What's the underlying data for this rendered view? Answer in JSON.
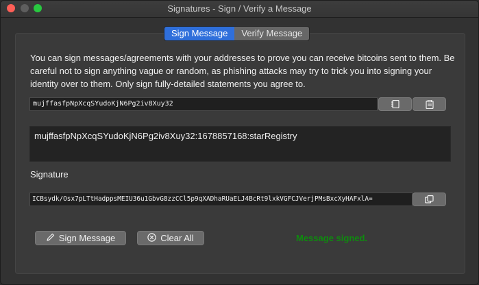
{
  "window": {
    "title": "Signatures - Sign / Verify a Message"
  },
  "tabs": [
    {
      "label": "Sign Message",
      "active": true
    },
    {
      "label": "Verify Message",
      "active": false
    }
  ],
  "sign": {
    "description": "You can sign messages/agreements with your addresses to prove you can receive bitcoins sent to them. Be careful not to sign anything vague or random, as phishing attacks may try to trick you into signing your identity over to them. Only sign fully-detailed statements you agree to.",
    "address_value": "mujffasfpNpXcqSYudoKjN6Pg2iv8Xuy32",
    "message_value": "mujffasfpNpXcqSYudoKjN6Pg2iv8Xuy32:1678857168:starRegistry",
    "signature_label": "Signature",
    "signature_value": "ICBsydk/Osx7pLTtHadppsMEIU36u1GbvG8zzCCl5p9qXADhaRUaELJ4BcRt9lxkVGFCJVerjPMsBxcXyHAFxlA=",
    "sign_button": "Sign Message",
    "clear_button": "Clear All",
    "status": "Message signed."
  },
  "icons": {
    "address_book": "address-book-icon",
    "paste": "paste-icon",
    "copy": "copy-icon",
    "pen": "pen-icon",
    "clear": "clear-icon"
  },
  "colors": {
    "accent": "#2f6fdb",
    "status_success": "#0f8a0f"
  }
}
